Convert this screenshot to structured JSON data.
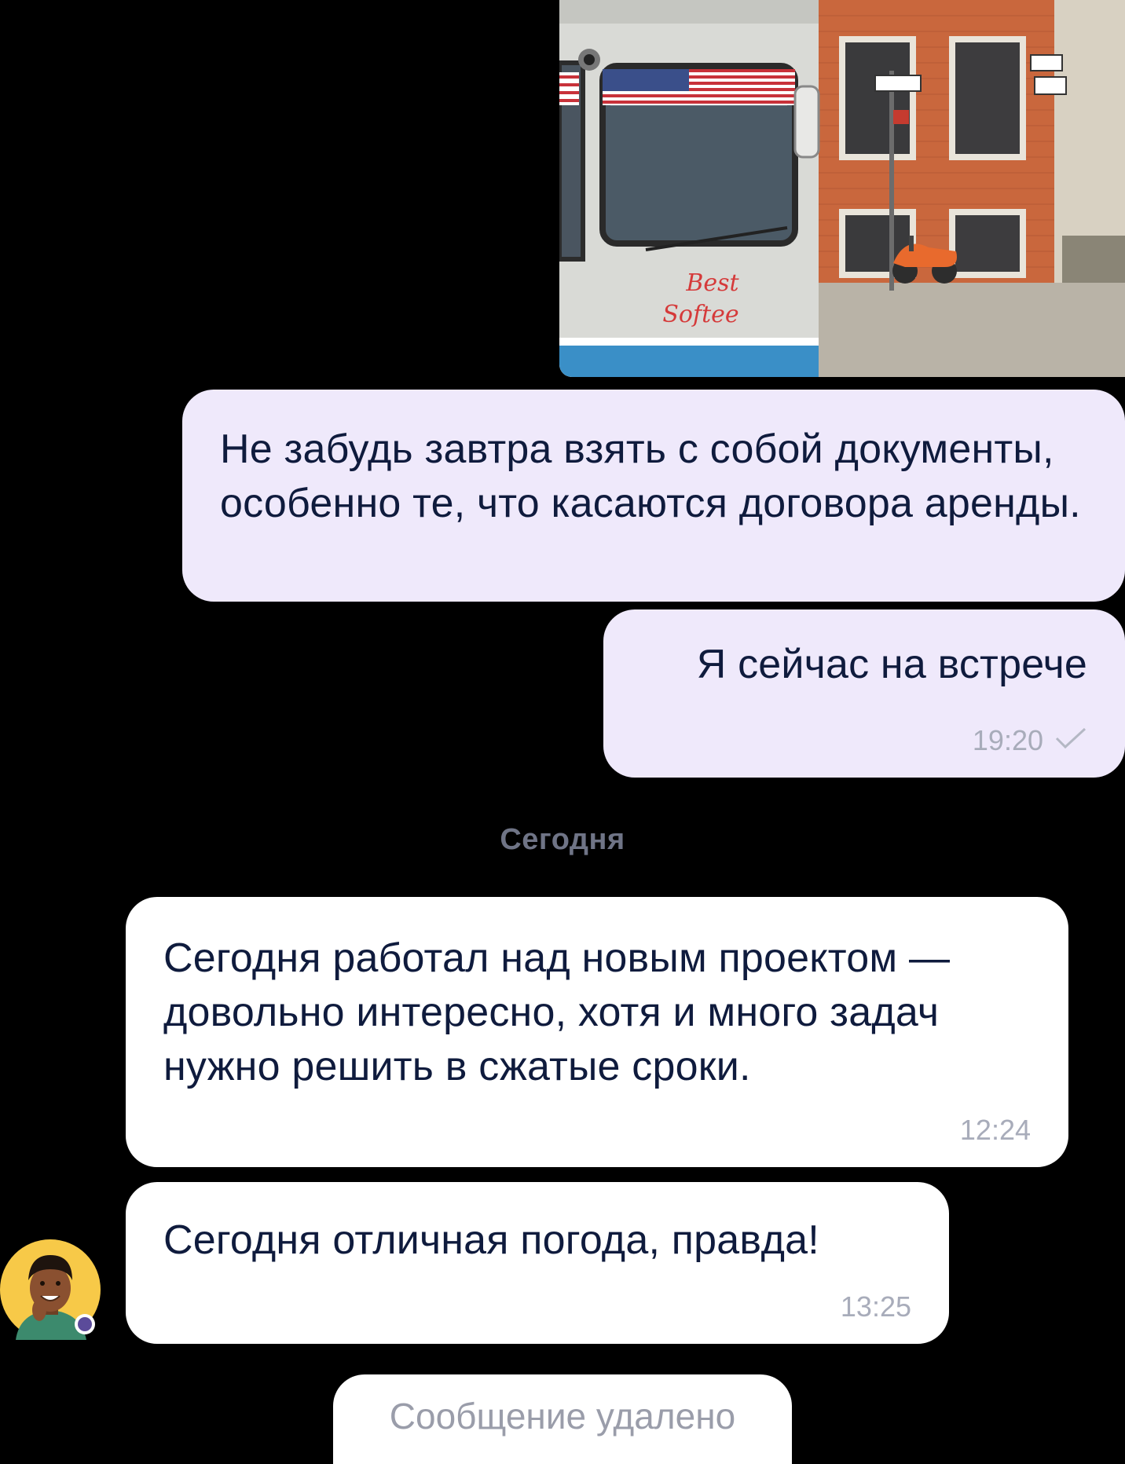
{
  "messages": [
    {
      "text": "Не забудь завтра взять с собой документы, особенно те, что касаются договора аренды."
    },
    {
      "text": "Я сейчас на встрече",
      "time": "19:20"
    },
    {
      "text": "Сегодня работал над новым проектом — довольно интересно, хотя и много задач нужно решить в сжатые сроки.",
      "time": "12:24"
    },
    {
      "text": "Сегодня отличная погода, правда!",
      "time": "13:25"
    }
  ],
  "date_separator": "Сегодня",
  "deleted_message": "Сообщение удалено",
  "photo": {
    "truck_text_1": "Best",
    "truck_text_2": "Softee"
  },
  "colors": {
    "outgoing_bubble": "#efe9fb",
    "incoming_bubble": "#ffffff",
    "text": "#0f1b3d",
    "meta": "#a8acba",
    "background": "#000000"
  }
}
